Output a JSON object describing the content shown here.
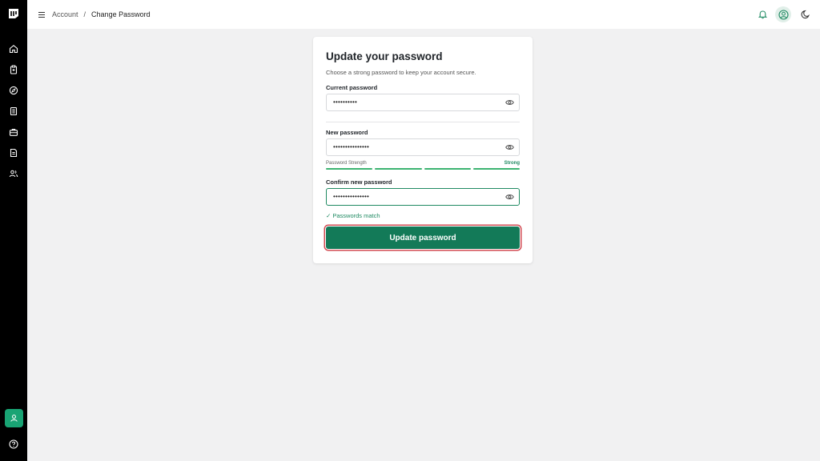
{
  "colors": {
    "sidebar_bg": "#000000",
    "accent": "#137a58",
    "success": "#1f8a62",
    "strength_bar": "#3cb371",
    "focus_ring": "#d24a52"
  },
  "sidebar": {
    "logo_icon": "brand-logo-icon",
    "items": [
      {
        "icon": "home-icon"
      },
      {
        "icon": "clipboard-icon"
      },
      {
        "icon": "compass-icon"
      },
      {
        "icon": "document-list-icon"
      },
      {
        "icon": "briefcase-icon"
      },
      {
        "icon": "file-text-icon"
      },
      {
        "icon": "users-icon"
      }
    ],
    "bottom": [
      {
        "icon": "user-icon"
      },
      {
        "icon": "help-circle-icon"
      }
    ]
  },
  "header": {
    "breadcrumb": {
      "parent": "Account",
      "separator": "/",
      "current": "Change Password"
    }
  },
  "form": {
    "title": "Update your password",
    "subtitle": "Choose a strong password to keep your account secure.",
    "current_label": "Current password",
    "current_value": "••••••••••",
    "new_label": "New password",
    "new_value": "•••••••••••••••",
    "strength_label": "Password Strength",
    "strength_value": "Strong",
    "strength_level": 4,
    "strength_max": 4,
    "confirm_label": "Confirm new password",
    "confirm_value": "•••••••••••••••",
    "match_message": "✓ Passwords match",
    "submit_label": "Update password"
  }
}
